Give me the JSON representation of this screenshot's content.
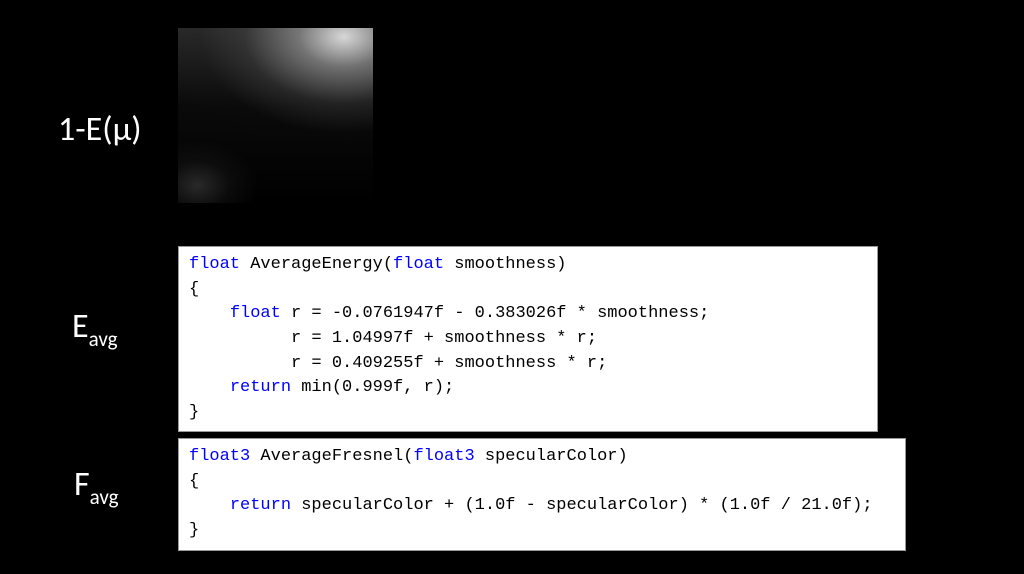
{
  "labels": {
    "energy_loss": {
      "pre": "1-E(",
      "mu": "μ",
      "post": ")"
    },
    "e_avg": {
      "base": "E",
      "sub": "avg"
    },
    "f_avg": {
      "base": "F",
      "sub": "avg"
    }
  },
  "code": {
    "average_energy": {
      "kw_float_1": "float",
      "sig_after": " AverageEnergy(",
      "kw_float_2": "float",
      "sig_tail": " smoothness)",
      "brace_open": "{",
      "indent1": "    ",
      "kw_float_3": "float",
      "line1_rest": " r = -0.0761947f - 0.383026f * smoothness;",
      "indent2": "          ",
      "line2_rest": "r = 1.04997f + smoothness * r;",
      "line3_rest": "r = 0.409255f + smoothness * r;",
      "kw_return": "return",
      "line4_rest": " min(0.999f, r);",
      "brace_close": "}"
    },
    "average_fresnel": {
      "kw_float3_1": "float3",
      "sig_after": " AverageFresnel(",
      "kw_float3_2": "float3",
      "sig_tail": " specularColor)",
      "brace_open": "{",
      "indent1": "    ",
      "kw_return": "return",
      "line1_rest": " specularColor + (1.0f - specularColor) * (1.0f / 21.0f);",
      "brace_close": "}"
    }
  }
}
